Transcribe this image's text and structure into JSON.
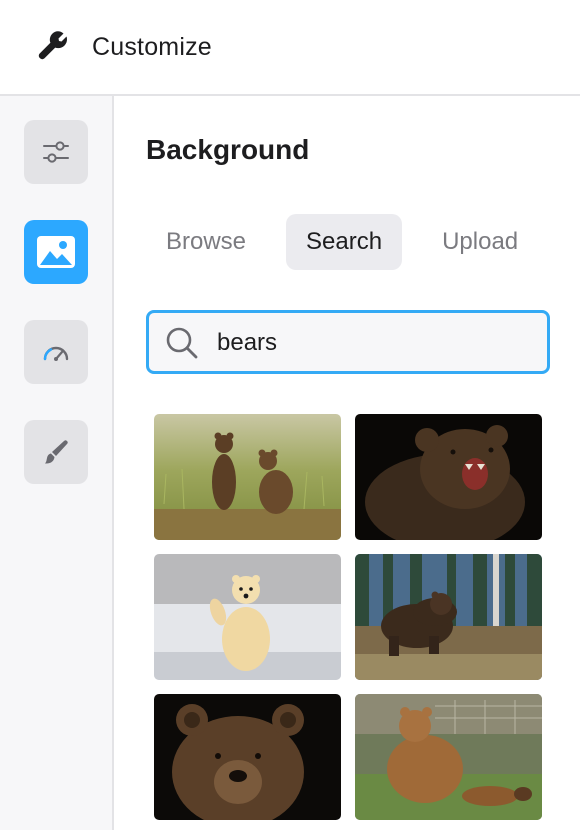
{
  "header": {
    "title": "Customize",
    "icon": "wrench-icon"
  },
  "sidebar": {
    "items": [
      {
        "name": "adjustments",
        "icon": "sliders-icon",
        "active": false
      },
      {
        "name": "background",
        "icon": "image-icon",
        "active": true
      },
      {
        "name": "performance",
        "icon": "gauge-icon",
        "active": false
      },
      {
        "name": "theme",
        "icon": "brush-icon",
        "active": false
      }
    ]
  },
  "main": {
    "title": "Background",
    "tabs": [
      {
        "label": "Browse",
        "active": false
      },
      {
        "label": "Search",
        "active": true
      },
      {
        "label": "Upload",
        "active": false
      }
    ],
    "search": {
      "value": "bears",
      "icon": "search-icon"
    },
    "results": [
      {
        "subject": "two brown bear cubs standing in grass"
      },
      {
        "subject": "roaring grizzly bear on black"
      },
      {
        "subject": "polar bear waving on snow"
      },
      {
        "subject": "brown bear walking by forest"
      },
      {
        "subject": "brown bear portrait on black"
      },
      {
        "subject": "brown bear sitting on grass"
      }
    ]
  },
  "colors": {
    "accent": "#2ca8ff",
    "focus_border": "#34aaf5",
    "tab_active_bg": "#ebebef"
  }
}
